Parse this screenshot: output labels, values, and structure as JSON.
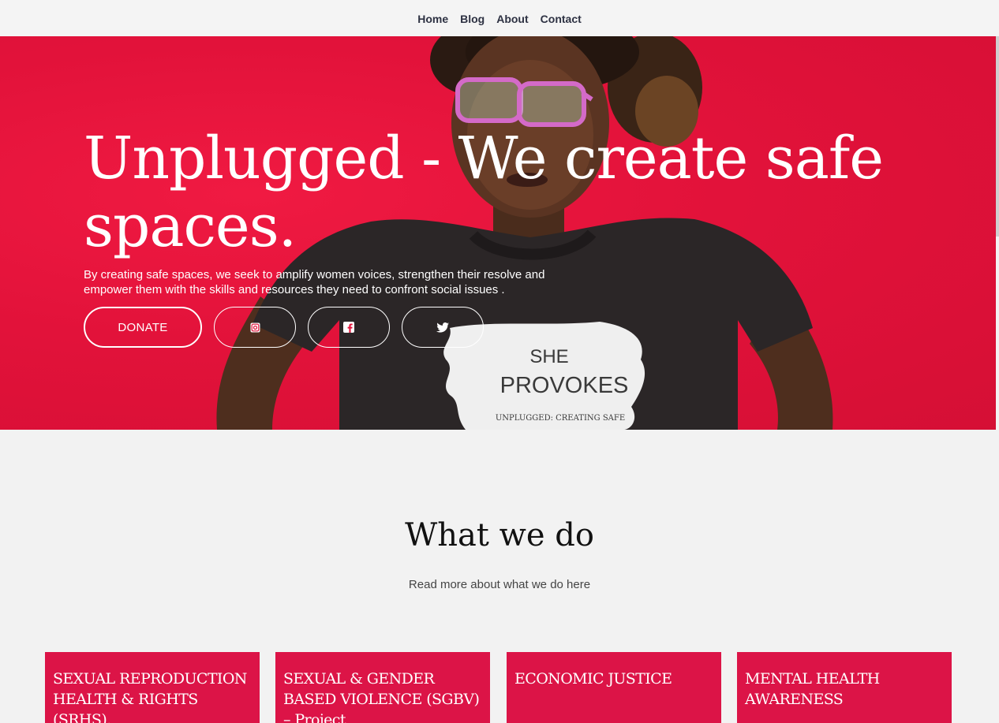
{
  "nav": {
    "items": [
      {
        "label": "Home"
      },
      {
        "label": "Blog"
      },
      {
        "label": "About"
      },
      {
        "label": "Contact"
      }
    ]
  },
  "hero": {
    "title": "Unplugged - We create safe spaces.",
    "subtitle": "By creating safe spaces, we seek to amplify women voices, strengthen their resolve and empower them with the skills and resources they need to confront social issues .",
    "donate_label": "DONATE",
    "social_icons": [
      "instagram-icon",
      "facebook-icon",
      "twitter-icon"
    ],
    "shirt_text": {
      "line1": "SHE",
      "line2": "PROVOKES",
      "line3": "UNPLUGGED: CREATING SAFE"
    },
    "colors": {
      "background": "#e2123a",
      "text": "#ffffff"
    }
  },
  "what_we_do": {
    "title": "What we do",
    "subtitle": "Read more about what we do here",
    "cards": [
      {
        "title": "SEXUAL REPRODUCTION HEALTH & RIGHTS (SRHS)."
      },
      {
        "title": "SEXUAL & GENDER BASED VIOLENCE (SGBV) – Project"
      },
      {
        "title": "ECONOMIC JUSTICE"
      },
      {
        "title": "MENTAL HEALTH AWARENESS"
      }
    ],
    "colors": {
      "card_background": "#dc1447",
      "card_text": "#ffffff"
    }
  }
}
